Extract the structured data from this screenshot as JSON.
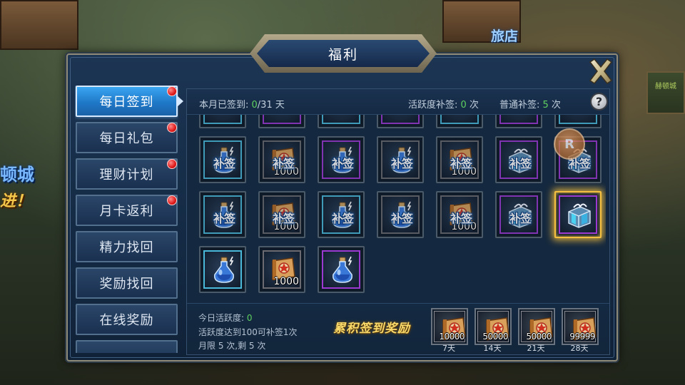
{
  "background": {
    "hotel_label": "旅店",
    "city_label": "顿城",
    "go_label": "进！",
    "sign_label": "赫顿城"
  },
  "window": {
    "title": "福利",
    "close_icon": "close-x-icon"
  },
  "sidebar": {
    "items": [
      {
        "label": "每日签到",
        "active": true,
        "red_dot": true
      },
      {
        "label": "每日礼包",
        "active": false,
        "red_dot": true
      },
      {
        "label": "理财计划",
        "active": false,
        "red_dot": true
      },
      {
        "label": "月卡返利",
        "active": false,
        "red_dot": true
      },
      {
        "label": "精力找回",
        "active": false,
        "red_dot": false
      },
      {
        "label": "奖励找回",
        "active": false,
        "red_dot": false
      },
      {
        "label": "在线奖励",
        "active": false,
        "red_dot": false
      }
    ]
  },
  "header": {
    "signed_prefix": "本月已签到: ",
    "signed_count": "0",
    "signed_suffix": "/31 天",
    "activity_prefix": "活跃度补签: ",
    "activity_count": "0",
    "activity_suffix": " 次",
    "normal_prefix": "普通补签: ",
    "normal_count": "5",
    "normal_suffix": " 次",
    "help_icon": "question-mark-icon",
    "help_label": "?"
  },
  "grid": {
    "stamp_label": "补签",
    "rows": [
      [
        {
          "item": "potion",
          "frame": "blue",
          "stamped": true
        },
        {
          "item": "scroll",
          "frame": "grey",
          "stamped": true,
          "qty": "1000"
        },
        {
          "item": "potion",
          "frame": "purple",
          "stamped": true
        },
        {
          "item": "potion",
          "frame": "grey",
          "stamped": true
        },
        {
          "item": "scroll",
          "frame": "grey",
          "stamped": true,
          "qty": "1000"
        },
        {
          "item": "chest",
          "frame": "purple",
          "stamped": true
        },
        {
          "item": "chest",
          "frame": "purple",
          "stamped": true
        }
      ],
      [
        {
          "item": "potion",
          "frame": "blue",
          "stamped": true
        },
        {
          "item": "scroll",
          "frame": "grey",
          "stamped": true,
          "qty": "1000"
        },
        {
          "item": "potion",
          "frame": "blue",
          "stamped": true
        },
        {
          "item": "potion",
          "frame": "grey",
          "stamped": true
        },
        {
          "item": "scroll",
          "frame": "grey",
          "stamped": true,
          "qty": "1000"
        },
        {
          "item": "chest",
          "frame": "purple",
          "stamped": true
        },
        {
          "item": "chest",
          "frame": "purple",
          "stamped": false,
          "highlight": true
        }
      ],
      [
        {
          "item": "potion",
          "frame": "blue",
          "stamped": false
        },
        {
          "item": "scroll",
          "frame": "grey",
          "stamped": false,
          "qty": "1000"
        },
        {
          "item": "potion",
          "frame": "purple",
          "stamped": false
        }
      ]
    ]
  },
  "footer": {
    "activity_today_prefix": "今日活跃度: ",
    "activity_today_value": "0",
    "rule_line": "活跃度达到100可补签1次",
    "limit_line": "月限 5 次,剩 5 次",
    "cumulative_title": "累积签到奖励",
    "rewards": [
      {
        "qty": "10000",
        "day": "7天"
      },
      {
        "qty": "50000",
        "day": "14天"
      },
      {
        "qty": "50000",
        "day": "21天"
      },
      {
        "qty": "99999",
        "day": "28天"
      }
    ]
  },
  "colors": {
    "accent_blue": "#2a8ee0",
    "green_number": "#5fd060",
    "gold_text": "#f8d96a",
    "red_dot": "#e01a1a",
    "frame_purple": "#9a3ad0",
    "frame_blue": "#4aa8c8",
    "highlight_gold": "#f5c040"
  }
}
